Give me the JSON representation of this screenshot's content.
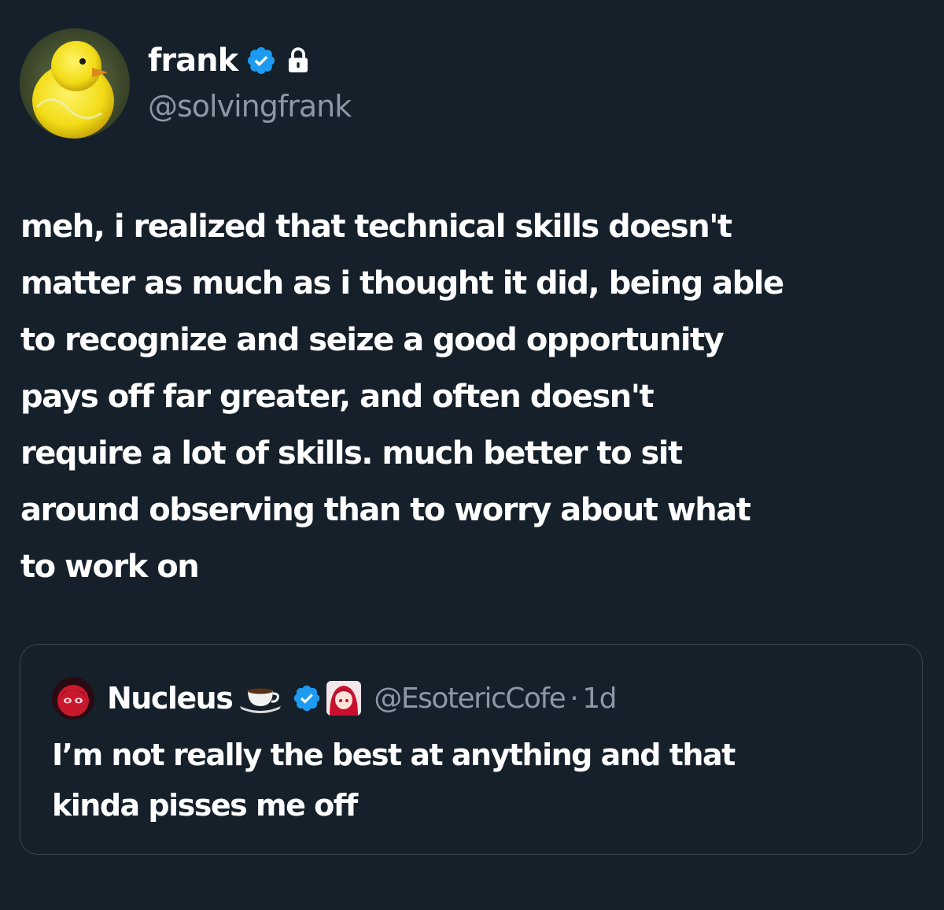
{
  "author": {
    "display_name": "frank",
    "handle": "@solvingfrank",
    "avatar_icon": "yellow-chick-avatar",
    "verified": true,
    "protected": true
  },
  "tweet": {
    "text": "meh, i realized that technical skills doesn't\nmatter as much as i thought it did, being able\nto recognize and seize a good opportunity\npays off far greater, and often doesn't\nrequire a lot of skills. much better to sit\naround observing than to worry about what\nto work on"
  },
  "quoted_tweet": {
    "display_name": "Nucleus",
    "name_emoji": "coffee-icon",
    "handle": "@EsotericCofe",
    "separator": "·",
    "time": "1d",
    "verified": true,
    "text": "I’m not really the best at anything and that\nkinda pisses me off"
  },
  "colors": {
    "background": "#15202b",
    "text_primary": "#ffffff",
    "text_secondary": "#8b98a5",
    "verified_blue": "#1d9bf0",
    "border": "#38444d"
  }
}
